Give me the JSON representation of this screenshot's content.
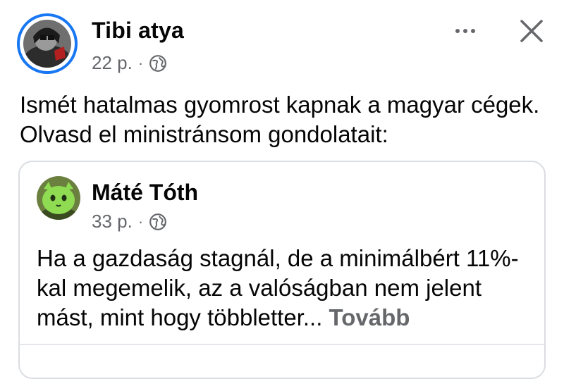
{
  "post": {
    "author": "Tibi atya",
    "time": "22 p.",
    "separator": "·",
    "text": "Ismét hatalmas gyomrost kapnak a magyar cégek. Olvasd el ministránsom gondolatait:"
  },
  "shared_post": {
    "author": "Máté Tóth",
    "time": "33 p.",
    "separator": "·",
    "text": "Ha a gazdaság stagnál, de a minimálbért 11%-kal megemelik, az a valóságban nem jelent mást, mint hogy többletter...",
    "more_label": "Tovább"
  },
  "icons": {
    "more": "more-horizontal-icon",
    "close": "close-icon",
    "privacy": "globe-icon"
  },
  "colors": {
    "accent": "#1877f2",
    "text": "#050505",
    "secondary": "#65676b",
    "border": "#dadde1"
  }
}
